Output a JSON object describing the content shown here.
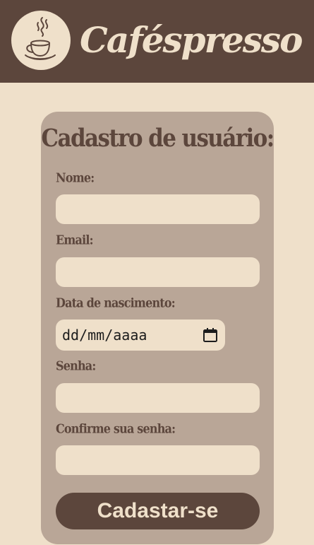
{
  "header": {
    "brand": "Caféspresso",
    "logo_icon": "coffee-cup-icon"
  },
  "form": {
    "title": "Cadastro de usuário:",
    "fields": {
      "name_label": "Nome:",
      "name_value": "",
      "email_label": "Email:",
      "email_value": "",
      "birthdate_label": "Data de nascimento:",
      "birthdate_value": "dd/mm/aaaa",
      "password_label": "Senha:",
      "password_value": "",
      "confirm_label": "Confirme sua senha:",
      "confirm_value": ""
    },
    "submit_label": "Cadastar-se"
  },
  "colors": {
    "header_bg": "#5c463c",
    "page_bg": "#efe0ca",
    "card_bg": "#b9a697",
    "text_dark": "#5c463c",
    "input_bg": "#efe0ca"
  }
}
